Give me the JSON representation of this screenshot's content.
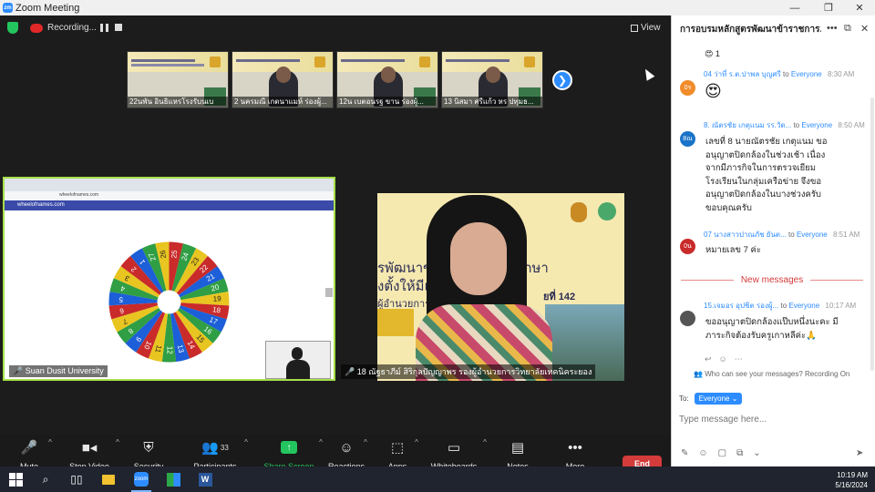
{
  "window": {
    "title": "Zoom Meeting",
    "logo_text": "zm",
    "controls": {
      "minimize": "—",
      "maximize": "❐",
      "close": "✕"
    }
  },
  "topbar": {
    "recording_label": "Recording...",
    "view_label": "View"
  },
  "thumbnails": [
    {
      "name": "22นพัน อินธิแหรโรงรับนเบ"
    },
    {
      "name": "2 นครมณี เกตนาแมห์ ร่องผู้..."
    },
    {
      "name": "12น เบตอนรฐ ขาน ร่องผู้..."
    },
    {
      "name": "13 นิสมา ศรีแก้ว หร ปทุมธ..."
    }
  ],
  "share": {
    "url": "wheelofnames.com",
    "site_name": "wheelofnames.com",
    "presenter_name": "Suan Dusit University",
    "wheel_numbers": [
      24,
      23,
      22,
      21,
      20,
      19,
      18,
      17,
      16,
      15,
      14,
      13,
      12,
      11,
      10,
      9,
      8,
      7,
      6,
      5,
      4,
      3,
      2,
      1,
      27,
      26,
      25
    ],
    "wheel_colors": [
      "#2f9e44",
      "#e8c520",
      "#c92a2a",
      "#1c5fd8"
    ]
  },
  "speaker": {
    "bg_line1": "รพัฒนาข้าราช           ทางการศึกษา",
    "bg_line2": "งตั้งให้มีและเ",
    "bg_line3": "ผู้อำนวยการและรอ",
    "bg_badge": "ยที่ 142",
    "name": "18 ณัฐธาภีม์ สิริกุลปัญญาพร รองผู้อำนวยการวิทยาลัยเทคนิคระยอง"
  },
  "controls": {
    "mute": "Mute",
    "stop_video": "Stop Video",
    "security": "Security",
    "participants": "Participants",
    "participants_count": "33",
    "share_screen": "Share Screen",
    "reactions": "Reactions",
    "apps": "Apps",
    "whiteboards": "Whiteboards",
    "notes": "Notes",
    "more": "More",
    "end": "End"
  },
  "chat": {
    "header_title": "การอบรมหลักสูตรพัฒนาข้าราชการ...",
    "top_reaction_count": "1",
    "messages": [
      {
        "avatar_text": "0ร",
        "avatar_color": "#f08c2a",
        "sender": "04 ว่าที่ ร.ต.ปาพล บุญศรี",
        "to": "to",
        "recipient": "Everyone",
        "time": "8:30 AM",
        "text": "😍"
      },
      {
        "avatar_text": "8ณ",
        "avatar_color": "#1a73c8",
        "sender": "8. ณัตรชัย เกตุแนม รร.วัด...",
        "to": "to",
        "recipient": "Everyone",
        "time": "8:50 AM",
        "lines": [
          "เลขที่ 8 นายณัตรชัย เกตุแนม  ขอ",
          "อนุญาตปิดกล้องในช่วงเช้า เนื่อง",
          "จากมีภารกิจในการตรวจเยียม",
          "โรงเรียนในกลุ่มเครือข่าย  จึงขอ",
          "อนุญาตปิดกล้องในบางช่วงครับ",
          "ขอบคุณครับ"
        ]
      },
      {
        "avatar_text": "0น",
        "avatar_color": "#c92a2a",
        "sender": "07 นางสาวปาณภัช ยันต...",
        "to": "to",
        "recipient": "Everyone",
        "time": "8:51 AM",
        "text": "หมายเลข 7 ค่ะ"
      },
      {
        "avatar_text": "",
        "avatar_color": "#555555",
        "sender": "15.เจมอร อุปชิต รองผู้...",
        "to": "to",
        "recipient": "Everyone",
        "time": "10:17 AM",
        "lines": [
          "ขออนุญาตปิดกล้องแป๊บหนึ่งนะคะ มี",
          "ภาระกิจต้องรับครูเกาหลีค่ะ🙏"
        ]
      }
    ],
    "new_messages_label": "New messages",
    "privacy_label": "Who can see your messages? Recording On",
    "to_label": "To:",
    "recipient_button": "Everyone",
    "input_placeholder": "Type message here..."
  },
  "taskbar": {
    "time": "10:19 AM",
    "date": "5/16/2024"
  }
}
